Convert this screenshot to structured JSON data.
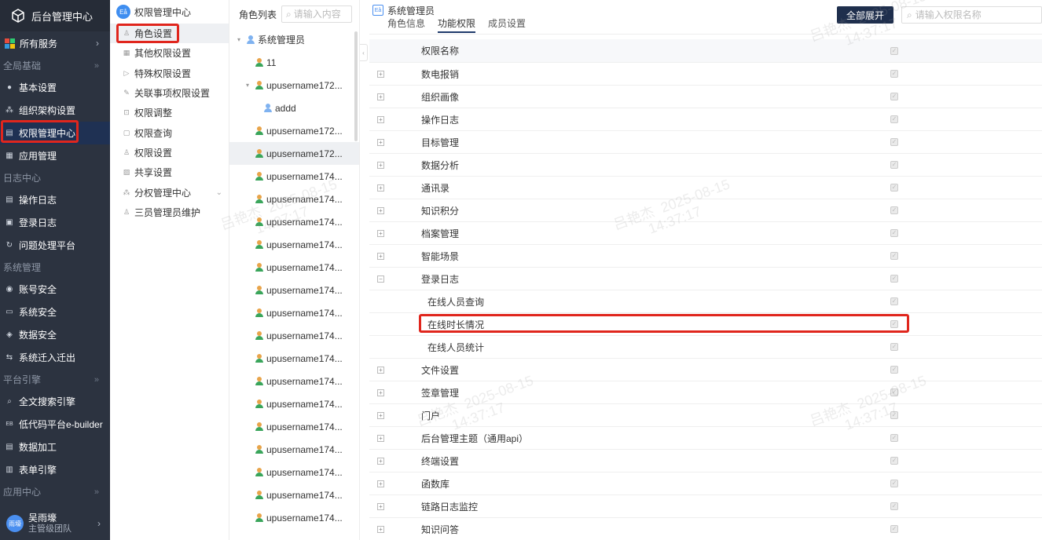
{
  "sidebar": {
    "app_title": "后台管理中心",
    "all_services": "所有服务",
    "sections": [
      {
        "label": "全局基础"
      },
      {
        "label": "日志中心"
      },
      {
        "label": "系统管理"
      },
      {
        "label": "平台引擎"
      },
      {
        "label": "应用中心"
      }
    ],
    "items": {
      "basic": "基本设置",
      "org": "组织架构设置",
      "perm_center": "权限管理中心",
      "app_mgmt": "应用管理",
      "op_log": "操作日志",
      "login_log": "登录日志",
      "issue": "问题处理平台",
      "account_sec": "账号安全",
      "sys_sec": "系统安全",
      "data_sec": "数据安全",
      "migrate": "系统迁入迁出",
      "fulltext": "全文搜索引擎",
      "lowcode": "低代码平台e-builder",
      "data_proc": "数据加工",
      "form_engine": "表单引擎"
    },
    "user": {
      "name": "吴雨壕",
      "team": "主管级团队",
      "avatar": "雨壕"
    }
  },
  "submenu": {
    "title": "权限管理中心",
    "badge": "Eå",
    "items": [
      "角色设置",
      "其他权限设置",
      "特殊权限设置",
      "关联事项权限设置",
      "权限调整",
      "权限查询",
      "权限设置",
      "共享设置",
      "分权管理中心",
      "三员管理员维护"
    ]
  },
  "rolelist": {
    "title": "角色列表",
    "search_placeholder": "请输入内容",
    "root": "系统管理员",
    "items": [
      "11",
      "upusername172...",
      "addd",
      "upusername172...",
      "upusername172...",
      "upusername174...",
      "upusername174...",
      "upusername174...",
      "upusername174...",
      "upusername174...",
      "upusername174...",
      "upusername174...",
      "upusername174...",
      "upusername174...",
      "upusername174...",
      "upusername174...",
      "upusername174...",
      "upusername174...",
      "upusername174...",
      "upusername174...",
      "upusername174..."
    ]
  },
  "main": {
    "title": "系统管理员",
    "tabs": [
      "角色信息",
      "功能权限",
      "成员设置"
    ],
    "expand_all": "全部展开",
    "search_placeholder": "请输入权限名称",
    "header": "权限名称",
    "rows": [
      "数电报销",
      "组织画像",
      "操作日志",
      "目标管理",
      "数据分析",
      "通讯录",
      "知识积分",
      "档案管理",
      "智能场景",
      "登录日志",
      "在线人员查询",
      "在线时长情况",
      "在线人员统计",
      "文件设置",
      "签章管理",
      "门户",
      "后台管理主题（通用api）",
      "终端设置",
      "函数库",
      "链路日志监控",
      "知识问答"
    ]
  },
  "watermark": {
    "name": "吕艳杰",
    "date": "2025-08-15",
    "time": "14:37:17"
  }
}
